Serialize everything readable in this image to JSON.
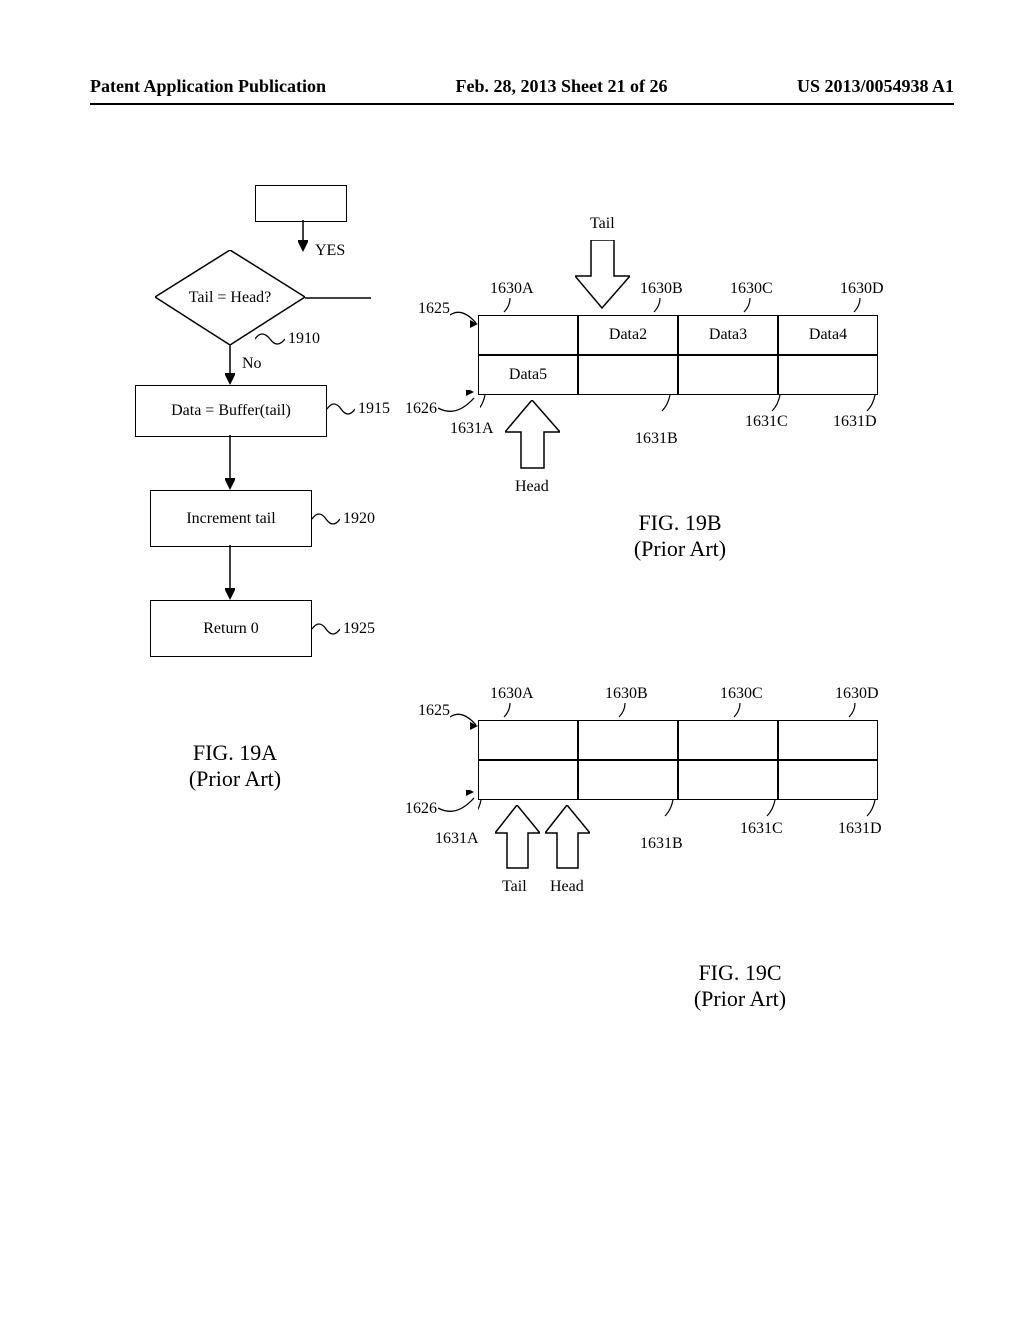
{
  "header": {
    "left": "Patent Application Publication",
    "mid": "Feb. 28, 2013  Sheet 21 of 26",
    "right": "US 2013/0054938 A1"
  },
  "fig19a": {
    "decision": "Tail = Head?",
    "yes": "YES",
    "no": "No",
    "ref_decision": "1910",
    "step1": "Data = Buffer(tail)",
    "ref_step1": "1915",
    "step2": "Increment tail",
    "ref_step2": "1920",
    "step3": "Return 0",
    "ref_step3": "1925",
    "caption_line1": "FIG. 19A",
    "caption_line2": "(Prior Art)"
  },
  "fig19b": {
    "tail_label": "Tail",
    "head_label": "Head",
    "row1_ref": "1625",
    "row2_ref": "1626",
    "top_refs": [
      "1630A",
      "1630B",
      "1630C",
      "1630D"
    ],
    "bot_refs": [
      "1631A",
      "1631B",
      "1631C",
      "1631D"
    ],
    "row1_cells": [
      "",
      "Data2",
      "Data3",
      "Data4"
    ],
    "row2_cells": [
      "Data5",
      "",
      "",
      ""
    ],
    "caption_line1": "FIG. 19B",
    "caption_line2": "(Prior Art)"
  },
  "fig19c": {
    "tail_label": "Tail",
    "head_label": "Head",
    "row1_ref": "1625",
    "row2_ref": "1626",
    "top_refs": [
      "1630A",
      "1630B",
      "1630C",
      "1630D"
    ],
    "bot_refs": [
      "1631A",
      "1631B",
      "1631C",
      "1631D"
    ],
    "row1_cells": [
      "",
      "",
      "",
      ""
    ],
    "row2_cells": [
      "",
      "",
      "",
      ""
    ],
    "caption_line1": "FIG. 19C",
    "caption_line2": "(Prior Art)"
  }
}
